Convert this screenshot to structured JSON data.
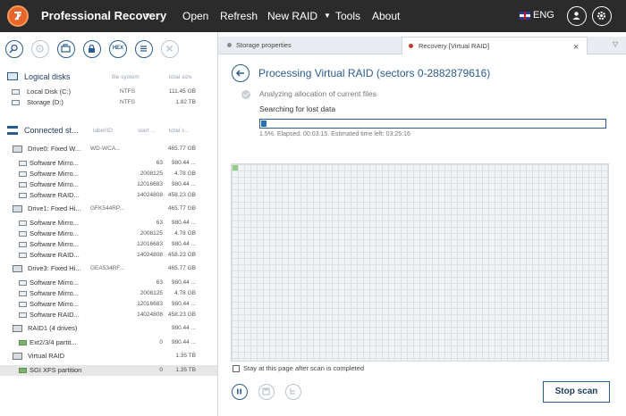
{
  "app": {
    "title": "Professional Recovery"
  },
  "menu": {
    "items": [
      "Open",
      "Refresh",
      "New RAID",
      "Tools",
      "About"
    ],
    "language": "ENG"
  },
  "toolbar": {
    "hex_label": "HEX"
  },
  "logical_disks": {
    "title": "Logical disks",
    "col_fs": "file system",
    "col_size": "total size",
    "items": [
      {
        "name": "Local Disk (C:)",
        "fs": "NTFS",
        "size": "111.45 GB"
      },
      {
        "name": "Storage (D:)",
        "fs": "NTFS",
        "size": "1.82 TB"
      }
    ]
  },
  "connected": {
    "title": "Connected st...",
    "col_label": "label/ID",
    "col_start": "start ...",
    "col_size": "total s...",
    "rows": [
      {
        "name": "Drive0: Fixed W...",
        "label": "WD-WCA...",
        "start": "",
        "size": "465.77 GB",
        "kind": "drive"
      },
      {
        "name": "Software Mirro...",
        "label": "",
        "start": "63",
        "size": "980.44 ...",
        "kind": "part"
      },
      {
        "name": "Software Mirro...",
        "label": "",
        "start": "2008125",
        "size": "4.78 GB",
        "kind": "part"
      },
      {
        "name": "Software Mirro...",
        "label": "",
        "start": "12016683",
        "size": "980.44 ...",
        "kind": "part"
      },
      {
        "name": "Software RAID...",
        "label": "",
        "start": "14024808",
        "size": "458.23 GB",
        "kind": "part"
      },
      {
        "name": "Drive1: Fixed Hi...",
        "label": "GFK544RP...",
        "start": "",
        "size": "465.77 GB",
        "kind": "drive"
      },
      {
        "name": "Software Mirro...",
        "label": "",
        "start": "63",
        "size": "980.44 ...",
        "kind": "part"
      },
      {
        "name": "Software Mirro...",
        "label": "",
        "start": "2008125",
        "size": "4.78 GB",
        "kind": "part"
      },
      {
        "name": "Software Mirro...",
        "label": "",
        "start": "12016683",
        "size": "980.44 ...",
        "kind": "part"
      },
      {
        "name": "Software RAID...",
        "label": "",
        "start": "14024808",
        "size": "458.23 GB",
        "kind": "part"
      },
      {
        "name": "Drive3: Fixed Hi...",
        "label": "GEA534RF...",
        "start": "",
        "size": "465.77 GB",
        "kind": "drive"
      },
      {
        "name": "Software Mirro...",
        "label": "",
        "start": "63",
        "size": "980.44 ...",
        "kind": "part"
      },
      {
        "name": "Software Mirro...",
        "label": "",
        "start": "2008125",
        "size": "4.78 GB",
        "kind": "part"
      },
      {
        "name": "Software Mirro...",
        "label": "",
        "start": "12016683",
        "size": "980.44 ...",
        "kind": "part"
      },
      {
        "name": "Software RAID...",
        "label": "",
        "start": "14024808",
        "size": "458.23 GB",
        "kind": "part"
      },
      {
        "name": "RAID1 (4 drives)",
        "label": "",
        "start": "",
        "size": "980.44 ...",
        "kind": "raid"
      },
      {
        "name": "Ext2/3/4 partit...",
        "label": "",
        "start": "0",
        "size": "980.44 ...",
        "kind": "gpart"
      },
      {
        "name": "Virtual RAID",
        "label": "",
        "start": "",
        "size": "1.35 TB",
        "kind": "raid"
      },
      {
        "name": "SGI XFS partition",
        "label": "",
        "start": "0",
        "size": "1.35 TB",
        "kind": "gpart"
      }
    ]
  },
  "tabs": [
    {
      "label": "Storage properties",
      "dot_color": "#8a8a8a"
    },
    {
      "label": "Recovery [Virtual RAID]",
      "dot_color": "#c0392b"
    }
  ],
  "process": {
    "title": "Processing Virtual RAID (sectors 0-2882879616)",
    "step_done": "Analyzing allocation of current files",
    "step_current": "Searching for lost data",
    "progress_percent": 1.5,
    "elapsed_text": "1.5%. Elapsed: 00:03:15. Estimated time left: 03:25:16",
    "stay_label": "Stay at this page after scan is completed",
    "stop_label": "Stop scan"
  },
  "colors": {
    "accent": "#2a5d8f",
    "topbar": "#2b2b2b",
    "logo": "#e8662a",
    "progress": "#2a6fb0",
    "grid_done": "#8fcf86"
  }
}
